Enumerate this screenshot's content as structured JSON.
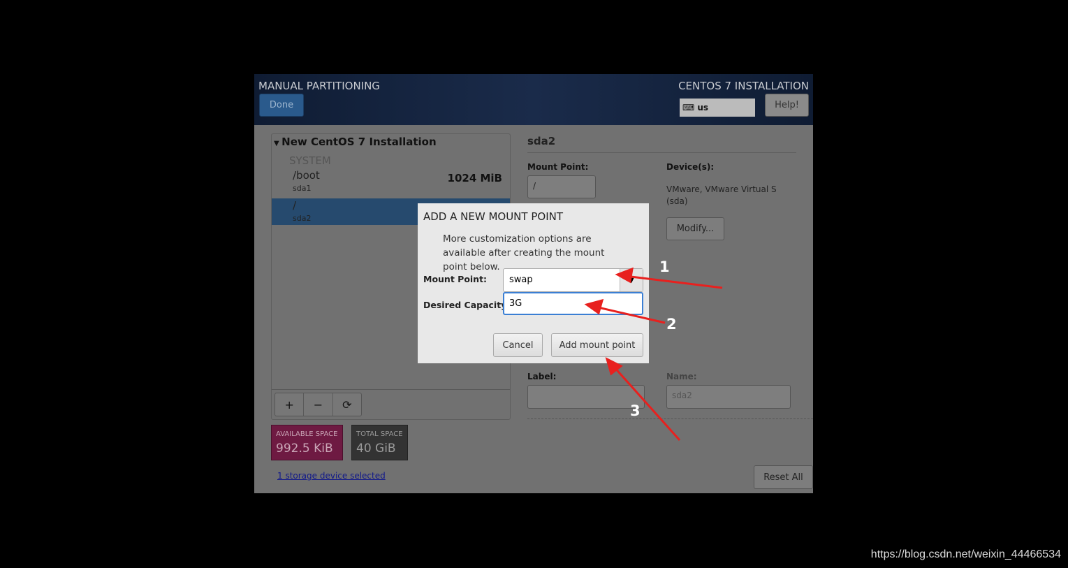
{
  "header": {
    "title": "MANUAL PARTITIONING",
    "done_label": "Done",
    "product": "CENTOS 7 INSTALLATION",
    "keyboard": "us",
    "help_label": "Help!"
  },
  "partitions": {
    "group": "New CentOS 7 Installation",
    "section": "SYSTEM",
    "items": [
      {
        "mount": "/boot",
        "device": "sda1",
        "size": "1024 MiB"
      },
      {
        "mount": "/",
        "device": "sda2",
        "size": ""
      }
    ],
    "tools": {
      "add": "+",
      "remove": "−",
      "refresh": "⟳"
    }
  },
  "space": {
    "available_label": "AVAILABLE SPACE",
    "available": "992.5 KiB",
    "total_label": "TOTAL SPACE",
    "total": "40 GiB"
  },
  "storage_link": "1 storage device selected",
  "detail": {
    "title": "sda2",
    "mount_label": "Mount Point:",
    "mount_value": "/",
    "devices_label": "Device(s):",
    "devices_value": "VMware, VMware Virtual S (sda)",
    "modify": "Modify...",
    "label_label": "Label:",
    "label_value": "",
    "name_label": "Name:",
    "name_value": "sda2",
    "reset": "Reset All"
  },
  "dialog": {
    "title": "ADD A NEW MOUNT POINT",
    "text": "More customization options are available after creating the mount point below.",
    "mount_label": "Mount Point:",
    "mount_value": "swap",
    "capacity_label": "Desired Capacity:",
    "capacity_value": "3G",
    "cancel": "Cancel",
    "add": "Add mount point"
  },
  "annotations": [
    "1",
    "2",
    "3"
  ],
  "annotation_color": "#e8201e",
  "watermark": "https://blog.csdn.net/weixin_44466534"
}
